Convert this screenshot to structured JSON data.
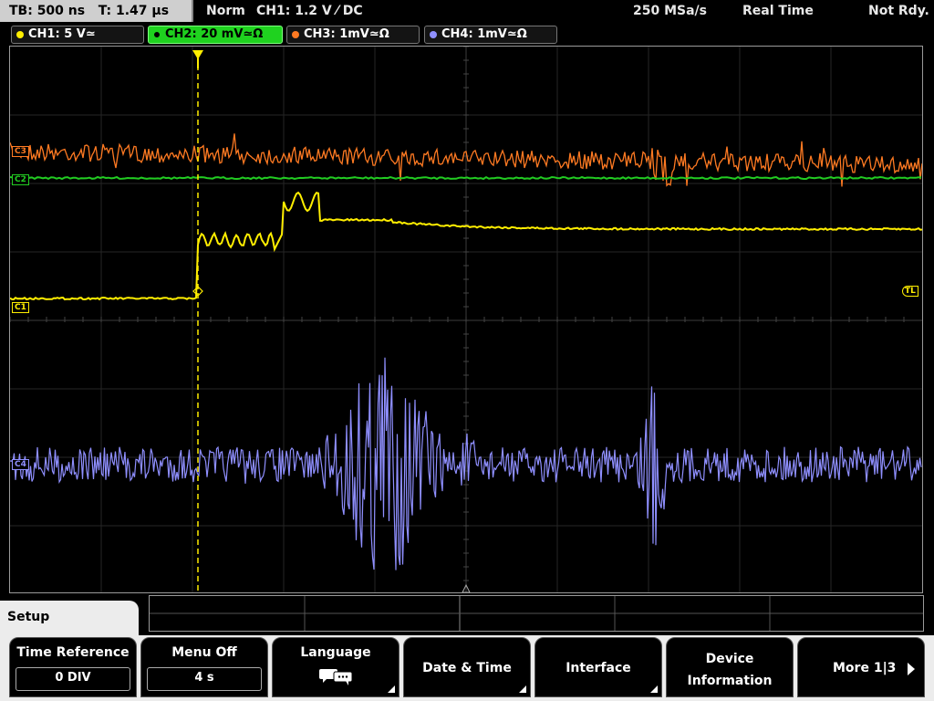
{
  "status": {
    "timebase": "TB: 500 ns",
    "trigger_time": "T: 1.47 µs",
    "trigger_mode": "Norm",
    "trigger_info": "CH1: 1.2 V ⁄ DC",
    "sample_rate": "250 MSa/s",
    "acq_mode": "Real Time",
    "state": "Not Rdy."
  },
  "channels": [
    {
      "label": "CH1: 5 V≃",
      "color": "#ffee00",
      "active": false
    },
    {
      "label": "CH2: 20 mV≃Ω",
      "color": "#22cc22",
      "active": true
    },
    {
      "label": "CH3: 1mV≃Ω",
      "color": "#ff7a22",
      "active": false
    },
    {
      "label": "CH4: 1mV≃Ω",
      "color": "#8f8fff",
      "active": false
    }
  ],
  "markers": {
    "ch1": "C1",
    "ch2": "C2",
    "ch3": "C3",
    "ch4": "C4",
    "trigger_level": "TL"
  },
  "menu": {
    "title": "Setup",
    "softkeys": [
      {
        "label": "Time Reference",
        "value": "0 DIV"
      },
      {
        "label": "Menu Off",
        "value": "4 s"
      },
      {
        "label": "Language",
        "icon": "speech-bubbles-icon"
      },
      {
        "label": "Date & Time"
      },
      {
        "label": "Interface"
      },
      {
        "label": "Device",
        "label2": "Information"
      },
      {
        "label": "More 1|3"
      }
    ]
  }
}
